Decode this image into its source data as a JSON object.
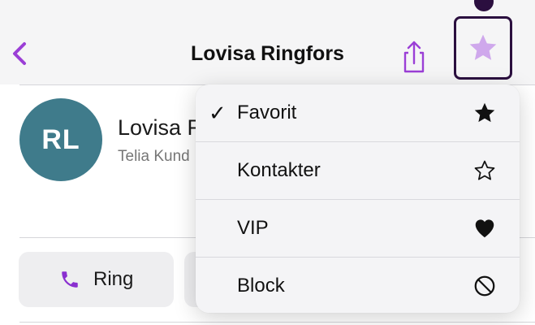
{
  "header": {
    "title": "Lovisa Ringfors",
    "back_icon": "chevron-left-icon",
    "share_icon": "share-icon",
    "favorite_icon": "star-icon"
  },
  "contact": {
    "initials": "RL",
    "name": "Lovisa R",
    "subtitle": "Telia Kund"
  },
  "actions": {
    "ring_label": "Ring",
    "ring_icon": "phone-icon"
  },
  "menu": {
    "items": [
      {
        "label": "Favorit",
        "checked": true,
        "icon": "star-filled-icon"
      },
      {
        "label": "Kontakter",
        "checked": false,
        "icon": "star-outline-icon"
      },
      {
        "label": "VIP",
        "checked": false,
        "icon": "heart-icon"
      },
      {
        "label": "Block",
        "checked": false,
        "icon": "block-icon"
      }
    ],
    "check_glyph": "✓"
  },
  "colors": {
    "accent": "#9b3fd6",
    "accent_light": "#cfa8ec",
    "focus_ring": "#2b0f3f",
    "avatar_bg": "#3f7b8b",
    "header_bg": "#f5f5f6"
  }
}
